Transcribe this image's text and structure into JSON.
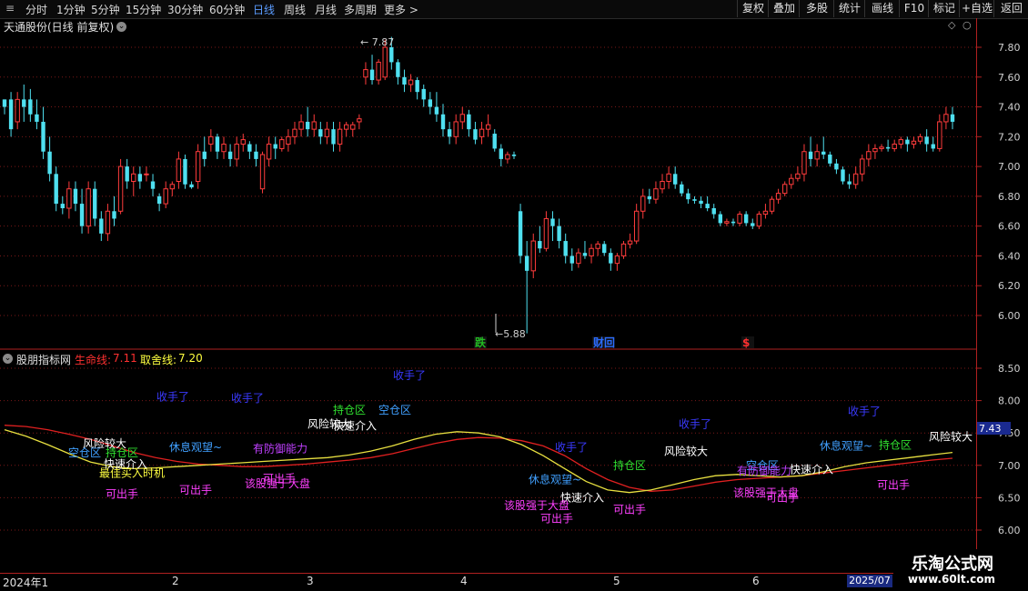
{
  "toolbar": {
    "timeframes": [
      {
        "label": "分时",
        "x": 28
      },
      {
        "label": "1分钟",
        "x": 62
      },
      {
        "label": "5分钟",
        "x": 100
      },
      {
        "label": "15分钟",
        "x": 138
      },
      {
        "label": "30分钟",
        "x": 184
      },
      {
        "label": "60分钟",
        "x": 230
      },
      {
        "label": "日线",
        "x": 278
      },
      {
        "label": "周线",
        "x": 312
      },
      {
        "label": "月线",
        "x": 346
      },
      {
        "label": "多周期",
        "x": 378
      },
      {
        "label": "更多 >",
        "x": 422
      }
    ],
    "active_timeframe": "日线",
    "buttons": [
      {
        "label": "复权",
        "x": 810,
        "w": 34
      },
      {
        "label": "叠加",
        "x": 844,
        "w": 34
      },
      {
        "label": "多股",
        "x": 878,
        "w": 38
      },
      {
        "label": "统计",
        "x": 916,
        "w": 34
      },
      {
        "label": "画线",
        "x": 950,
        "w": 38
      },
      {
        "label": "F10",
        "x": 988,
        "w": 32
      },
      {
        "label": "标记",
        "x": 1020,
        "w": 34
      },
      {
        "label": "+自选",
        "x": 1054,
        "w": 38
      },
      {
        "label": "返回",
        "x": 1092,
        "w": 38
      }
    ]
  },
  "price_panel": {
    "title": "天通股份(日线 前复权)",
    "y_ticks": [
      "7.80",
      "7.60",
      "7.40",
      "7.20",
      "7.00",
      "6.80",
      "6.60",
      "6.40",
      "6.20",
      "6.00"
    ],
    "high_label": "7.87",
    "low_label": "5.88",
    "event_markers": [
      {
        "label": "跌",
        "color": "#22bb22"
      },
      {
        "label": "财",
        "color": "#2b6cff",
        "extra": "回"
      },
      {
        "label": "$",
        "color": "#ff3030"
      }
    ]
  },
  "indicator_panel": {
    "title": "股朋指标网",
    "life_line_label": "生命线:",
    "life_line_value": "7.11",
    "take_line_label": "取舍线:",
    "take_line_value": "7.20",
    "current_value": "7.43",
    "y_ticks": [
      "8.50",
      "8.00",
      "7.50",
      "7.00",
      "6.50",
      "6.00"
    ]
  },
  "date_axis": {
    "labels": [
      "2024年1",
      "2",
      "3",
      "4",
      "5",
      "6",
      "2025/07"
    ]
  },
  "watermark": {
    "title": "乐淘公式网",
    "url": "www.60lt.com"
  },
  "colors": {
    "up": "#ff3c3c",
    "down": "#4fe0f0",
    "life_line": "#e02020",
    "take_line": "#e8e040",
    "grid": "#8a1a1a",
    "axis": "#b02020"
  },
  "chart_data": {
    "type": "candlestick",
    "price_range": [
      5.85,
      7.9
    ],
    "ohlc": [
      [
        7.45,
        7.45,
        7.35,
        7.4
      ],
      [
        7.45,
        7.5,
        7.2,
        7.25
      ],
      [
        7.3,
        7.5,
        7.25,
        7.45
      ],
      [
        7.45,
        7.55,
        7.3,
        7.4
      ],
      [
        7.45,
        7.52,
        7.3,
        7.35
      ],
      [
        7.35,
        7.45,
        7.25,
        7.3
      ],
      [
        7.3,
        7.4,
        7.05,
        7.1
      ],
      [
        7.1,
        7.2,
        6.9,
        6.95
      ],
      [
        6.95,
        7.0,
        6.7,
        6.75
      ],
      [
        6.75,
        6.8,
        6.68,
        6.72
      ],
      [
        6.72,
        6.9,
        6.65,
        6.85
      ],
      [
        6.85,
        6.9,
        6.7,
        6.75
      ],
      [
        6.75,
        6.85,
        6.55,
        6.6
      ],
      [
        6.6,
        6.9,
        6.55,
        6.85
      ],
      [
        6.85,
        6.9,
        6.6,
        6.65
      ],
      [
        6.65,
        6.7,
        6.5,
        6.55
      ],
      [
        6.55,
        6.75,
        6.5,
        6.7
      ],
      [
        6.7,
        6.8,
        6.6,
        6.65
      ],
      [
        6.7,
        7.05,
        6.68,
        7.0
      ],
      [
        7.0,
        7.05,
        6.85,
        6.9
      ],
      [
        6.9,
        7.0,
        6.8,
        6.95
      ],
      [
        6.95,
        7.0,
        6.85,
        6.9
      ],
      [
        6.95,
        7.0,
        6.9,
        6.95
      ],
      [
        6.9,
        6.95,
        6.8,
        6.85
      ],
      [
        6.8,
        6.82,
        6.7,
        6.75
      ],
      [
        6.75,
        6.9,
        6.72,
        6.85
      ],
      [
        6.85,
        6.9,
        6.8,
        6.88
      ],
      [
        6.9,
        7.1,
        6.85,
        7.05
      ],
      [
        7.05,
        7.08,
        6.85,
        6.88
      ],
      [
        6.88,
        6.9,
        6.85,
        6.86
      ],
      [
        6.9,
        7.15,
        6.85,
        7.1
      ],
      [
        7.1,
        7.2,
        7.0,
        7.05
      ],
      [
        7.15,
        7.25,
        7.1,
        7.2
      ],
      [
        7.2,
        7.22,
        7.05,
        7.1
      ],
      [
        7.1,
        7.2,
        7.05,
        7.15
      ],
      [
        7.1,
        7.15,
        7.0,
        7.05
      ],
      [
        7.05,
        7.2,
        7.0,
        7.15
      ],
      [
        7.15,
        7.22,
        7.1,
        7.18
      ],
      [
        7.15,
        7.17,
        7.05,
        7.1
      ],
      [
        7.1,
        7.15,
        7.0,
        7.05
      ],
      [
        6.85,
        7.1,
        6.82,
        7.08
      ],
      [
        7.05,
        7.2,
        7.0,
        7.15
      ],
      [
        7.15,
        7.2,
        7.05,
        7.12
      ],
      [
        7.12,
        7.2,
        7.1,
        7.18
      ],
      [
        7.15,
        7.25,
        7.1,
        7.2
      ],
      [
        7.2,
        7.3,
        7.15,
        7.25
      ],
      [
        7.25,
        7.35,
        7.2,
        7.3
      ],
      [
        7.3,
        7.4,
        7.2,
        7.25
      ],
      [
        7.25,
        7.35,
        7.2,
        7.3
      ],
      [
        7.25,
        7.3,
        7.15,
        7.2
      ],
      [
        7.2,
        7.3,
        7.15,
        7.25
      ],
      [
        7.25,
        7.3,
        7.1,
        7.15
      ],
      [
        7.15,
        7.3,
        7.1,
        7.25
      ],
      [
        7.25,
        7.3,
        7.2,
        7.28
      ],
      [
        7.25,
        7.3,
        7.2,
        7.28
      ],
      [
        7.3,
        7.35,
        7.25,
        7.32
      ],
      [
        7.6,
        7.7,
        7.55,
        7.65
      ],
      [
        7.65,
        7.75,
        7.55,
        7.58
      ],
      [
        7.58,
        7.72,
        7.55,
        7.7
      ],
      [
        7.6,
        7.85,
        7.58,
        7.8
      ],
      [
        7.8,
        7.87,
        7.65,
        7.7
      ],
      [
        7.7,
        7.72,
        7.55,
        7.6
      ],
      [
        7.6,
        7.65,
        7.5,
        7.55
      ],
      [
        7.55,
        7.62,
        7.5,
        7.58
      ],
      [
        7.58,
        7.6,
        7.45,
        7.5
      ],
      [
        7.52,
        7.55,
        7.4,
        7.45
      ],
      [
        7.45,
        7.5,
        7.35,
        7.4
      ],
      [
        7.4,
        7.5,
        7.3,
        7.35
      ],
      [
        7.35,
        7.42,
        7.2,
        7.25
      ],
      [
        7.25,
        7.3,
        7.15,
        7.2
      ],
      [
        7.2,
        7.35,
        7.15,
        7.3
      ],
      [
        7.3,
        7.4,
        7.25,
        7.35
      ],
      [
        7.35,
        7.38,
        7.2,
        7.25
      ],
      [
        7.25,
        7.3,
        7.15,
        7.18
      ],
      [
        7.2,
        7.3,
        7.15,
        7.25
      ],
      [
        7.25,
        7.35,
        7.2,
        7.28
      ],
      [
        7.22,
        7.25,
        7.1,
        7.12
      ],
      [
        7.12,
        7.15,
        7.0,
        7.05
      ],
      [
        7.05,
        7.1,
        7.02,
        7.08
      ],
      [
        7.08,
        7.1,
        7.05,
        7.07
      ],
      [
        6.7,
        6.75,
        6.35,
        6.4
      ],
      [
        6.4,
        6.5,
        5.88,
        6.3
      ],
      [
        6.3,
        6.55,
        6.25,
        6.5
      ],
      [
        6.5,
        6.6,
        6.42,
        6.45
      ],
      [
        6.45,
        6.7,
        6.43,
        6.65
      ],
      [
        6.65,
        6.7,
        6.5,
        6.6
      ],
      [
        6.6,
        6.65,
        6.45,
        6.5
      ],
      [
        6.5,
        6.55,
        6.35,
        6.4
      ],
      [
        6.4,
        6.45,
        6.3,
        6.35
      ],
      [
        6.35,
        6.45,
        6.32,
        6.42
      ],
      [
        6.42,
        6.5,
        6.38,
        6.4
      ],
      [
        6.4,
        6.48,
        6.35,
        6.45
      ],
      [
        6.45,
        6.5,
        6.4,
        6.48
      ],
      [
        6.48,
        6.5,
        6.4,
        6.42
      ],
      [
        6.42,
        6.45,
        6.3,
        6.35
      ],
      [
        6.35,
        6.42,
        6.3,
        6.4
      ],
      [
        6.4,
        6.5,
        6.38,
        6.48
      ],
      [
        6.48,
        6.55,
        6.45,
        6.5
      ],
      [
        6.5,
        6.75,
        6.48,
        6.7
      ],
      [
        6.7,
        6.85,
        6.65,
        6.8
      ],
      [
        6.8,
        6.85,
        6.75,
        6.78
      ],
      [
        6.78,
        6.9,
        6.75,
        6.85
      ],
      [
        6.85,
        6.95,
        6.82,
        6.9
      ],
      [
        6.9,
        7.0,
        6.85,
        6.95
      ],
      [
        6.95,
        7.0,
        6.85,
        6.88
      ],
      [
        6.88,
        6.9,
        6.8,
        6.82
      ],
      [
        6.82,
        6.85,
        6.75,
        6.78
      ],
      [
        6.78,
        6.8,
        6.75,
        6.77
      ],
      [
        6.77,
        6.8,
        6.72,
        6.75
      ],
      [
        6.75,
        6.8,
        6.7,
        6.72
      ],
      [
        6.72,
        6.75,
        6.65,
        6.68
      ],
      [
        6.68,
        6.7,
        6.6,
        6.62
      ],
      [
        6.62,
        6.65,
        6.6,
        6.63
      ],
      [
        6.63,
        6.65,
        6.6,
        6.62
      ],
      [
        6.62,
        6.7,
        6.6,
        6.68
      ],
      [
        6.68,
        6.7,
        6.6,
        6.62
      ],
      [
        6.62,
        6.65,
        6.58,
        6.6
      ],
      [
        6.6,
        6.7,
        6.58,
        6.68
      ],
      [
        6.68,
        6.75,
        6.65,
        6.7
      ],
      [
        6.7,
        6.8,
        6.68,
        6.78
      ],
      [
        6.78,
        6.85,
        6.75,
        6.82
      ],
      [
        6.82,
        6.9,
        6.8,
        6.88
      ],
      [
        6.88,
        6.95,
        6.85,
        6.92
      ],
      [
        6.92,
        7.0,
        6.9,
        6.95
      ],
      [
        6.95,
        7.15,
        6.9,
        7.1
      ],
      [
        7.1,
        7.2,
        7.0,
        7.05
      ],
      [
        7.05,
        7.15,
        7.0,
        7.1
      ],
      [
        7.1,
        7.2,
        7.05,
        7.08
      ],
      [
        7.08,
        7.1,
        7.0,
        7.02
      ],
      [
        7.02,
        7.05,
        6.95,
        6.98
      ],
      [
        6.98,
        7.0,
        6.88,
        6.9
      ],
      [
        6.9,
        6.95,
        6.85,
        6.88
      ],
      [
        6.88,
        7.0,
        6.85,
        6.95
      ],
      [
        6.95,
        7.08,
        6.9,
        7.05
      ],
      [
        7.05,
        7.15,
        7.0,
        7.1
      ],
      [
        7.1,
        7.15,
        7.05,
        7.12
      ],
      [
        7.12,
        7.15,
        7.1,
        7.13
      ],
      [
        7.13,
        7.18,
        7.1,
        7.12
      ],
      [
        7.12,
        7.18,
        7.1,
        7.15
      ],
      [
        7.15,
        7.2,
        7.12,
        7.18
      ],
      [
        7.18,
        7.2,
        7.1,
        7.15
      ],
      [
        7.15,
        7.2,
        7.12,
        7.17
      ],
      [
        7.17,
        7.22,
        7.15,
        7.2
      ],
      [
        7.2,
        7.25,
        7.1,
        7.15
      ],
      [
        7.15,
        7.2,
        7.1,
        7.12
      ],
      [
        7.12,
        7.35,
        7.1,
        7.3
      ],
      [
        7.3,
        7.4,
        7.25,
        7.35
      ],
      [
        7.35,
        7.4,
        7.25,
        7.3
      ]
    ],
    "life_line": [
      7.62,
      7.6,
      7.55,
      7.48,
      7.4,
      7.3,
      7.2,
      7.12,
      7.06,
      7.02,
      7.0,
      6.98,
      6.98,
      7.0,
      7.02,
      7.05,
      7.08,
      7.12,
      7.18,
      7.26,
      7.34,
      7.4,
      7.43,
      7.42,
      7.38,
      7.3,
      7.15,
      6.95,
      6.78,
      6.66,
      6.6,
      6.62,
      6.68,
      6.74,
      6.78,
      6.8,
      6.82,
      6.84,
      6.88,
      6.92,
      6.96,
      7.0,
      7.04,
      7.08,
      7.11
    ],
    "take_line": [
      7.55,
      7.45,
      7.32,
      7.18,
      7.05,
      6.98,
      6.95,
      6.96,
      6.98,
      7.0,
      7.02,
      7.04,
      7.06,
      7.08,
      7.1,
      7.12,
      7.16,
      7.22,
      7.3,
      7.4,
      7.48,
      7.52,
      7.5,
      7.44,
      7.32,
      7.15,
      6.95,
      6.75,
      6.62,
      6.58,
      6.62,
      6.7,
      6.78,
      6.84,
      6.86,
      6.84,
      6.82,
      6.84,
      6.9,
      6.98,
      7.04,
      7.08,
      7.12,
      7.16,
      7.2
    ],
    "indicator_range": [
      5.8,
      8.7
    ],
    "signals": [
      {
        "text": "收手了",
        "color": "#3a3aff",
        "x": 190,
        "v": 8.0
      },
      {
        "text": "收手了",
        "color": "#3a3aff",
        "x": 272,
        "v": 7.98
      },
      {
        "text": "收手了",
        "color": "#3a3aff",
        "x": 450,
        "v": 8.33
      },
      {
        "text": "收手了",
        "color": "#3a3aff",
        "x": 628,
        "v": 7.22
      },
      {
        "text": "收手了",
        "color": "#3a3aff",
        "x": 764,
        "v": 7.58
      },
      {
        "text": "收手了",
        "color": "#3a3aff",
        "x": 950,
        "v": 7.78
      },
      {
        "text": "持仓区",
        "color": "#30e030",
        "x": 384,
        "v": 7.8
      },
      {
        "text": "空仓区",
        "color": "#40a0ff",
        "x": 434,
        "v": 7.8
      },
      {
        "text": "风险较大",
        "color": "#ffffff",
        "x": 362,
        "v": 7.58
      },
      {
        "text": "快速介入",
        "color": "#ffffff",
        "x": 390,
        "v": 7.55
      },
      {
        "text": "风险较大",
        "color": "#ffffff",
        "x": 115,
        "v": 7.28
      },
      {
        "text": "空仓区",
        "color": "#40a0ff",
        "x": 93,
        "v": 7.14
      },
      {
        "text": "持仓区",
        "color": "#30e030",
        "x": 134,
        "v": 7.14
      },
      {
        "text": "快速介入",
        "color": "#ffffff",
        "x": 138,
        "v": 6.96
      },
      {
        "text": "最佳买入时机",
        "color": "#ffff40",
        "x": 145,
        "v": 6.82
      },
      {
        "text": "休息观望~",
        "color": "#40a0ff",
        "x": 215,
        "v": 7.22
      },
      {
        "text": "有防御能力",
        "color": "#c040ff",
        "x": 308,
        "v": 7.2
      },
      {
        "text": "可出手",
        "color": "#ff40ff",
        "x": 307,
        "v": 6.74
      },
      {
        "text": "该股强于大盘",
        "color": "#ff40ff",
        "x": 305,
        "v": 6.66
      },
      {
        "text": "可出手",
        "color": "#ff40ff",
        "x": 134,
        "v": 6.5
      },
      {
        "text": "可出手",
        "color": "#ff40ff",
        "x": 215,
        "v": 6.56
      },
      {
        "text": "休息观望~",
        "color": "#40a0ff",
        "x": 610,
        "v": 6.72
      },
      {
        "text": "快速介入",
        "color": "#ffffff",
        "x": 640,
        "v": 6.44
      },
      {
        "text": "该股强于大盘",
        "color": "#ff40ff",
        "x": 590,
        "v": 6.32
      },
      {
        "text": "可出手",
        "color": "#ff40ff",
        "x": 612,
        "v": 6.12
      },
      {
        "text": "持仓区",
        "color": "#30e030",
        "x": 692,
        "v": 6.94
      },
      {
        "text": "可出手",
        "color": "#ff40ff",
        "x": 692,
        "v": 6.26
      },
      {
        "text": "风险较大",
        "color": "#ffffff",
        "x": 754,
        "v": 7.16
      },
      {
        "text": "空仓区",
        "color": "#40a0ff",
        "x": 838,
        "v": 6.94
      },
      {
        "text": "有防御能力",
        "color": "#c040ff",
        "x": 840,
        "v": 6.86
      },
      {
        "text": "快速介入",
        "color": "#ffffff",
        "x": 892,
        "v": 6.88
      },
      {
        "text": "该股强于大盘",
        "color": "#ff40ff",
        "x": 842,
        "v": 6.52
      },
      {
        "text": "可出手",
        "color": "#ff40ff",
        "x": 860,
        "v": 6.44
      },
      {
        "text": "休息观望~",
        "color": "#40a0ff",
        "x": 930,
        "v": 7.24
      },
      {
        "text": "持仓区",
        "color": "#30e030",
        "x": 984,
        "v": 7.26
      },
      {
        "text": "风险较大",
        "color": "#ffffff",
        "x": 1045,
        "v": 7.38
      },
      {
        "text": "可出手",
        "color": "#ff40ff",
        "x": 982,
        "v": 6.64
      }
    ]
  }
}
